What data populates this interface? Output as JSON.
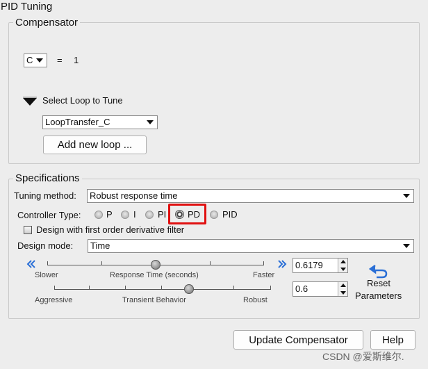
{
  "window": {
    "title": "PID Tuning"
  },
  "compensator": {
    "title": "Compensator",
    "compensator_select": "C",
    "equals": "=",
    "value": "1",
    "select_loop_label": "Select Loop to Tune",
    "loop_select": "LoopTransfer_C",
    "add_loop_label": "Add new loop ..."
  },
  "specifications": {
    "title": "Specifications",
    "tuning_method_label": "Tuning method:",
    "tuning_method_value": "Robust response time",
    "controller_type_label": "Controller Type:",
    "controller_types": [
      "P",
      "I",
      "PI",
      "PD",
      "PID"
    ],
    "controller_type_selected": "PD",
    "derivative_filter_label": "Design with first order derivative filter",
    "derivative_filter_checked": false,
    "design_mode_label": "Design mode:",
    "design_mode_value": "Time",
    "response_slider": {
      "left_label": "Slower",
      "center_label": "Response Time (seconds)",
      "right_label": "Faster",
      "value": "0.6179",
      "position_fraction": 0.5
    },
    "transient_slider": {
      "left_label": "Aggressive",
      "center_label": "Transient Behavior",
      "right_label": "Robust",
      "value": "0.6",
      "position_fraction": 0.6
    },
    "reset_label_line1": "Reset",
    "reset_label_line2": "Parameters"
  },
  "footer": {
    "update_label": "Update Compensator",
    "help_label": "Help"
  },
  "watermark": "CSDN @爱斯维尔."
}
